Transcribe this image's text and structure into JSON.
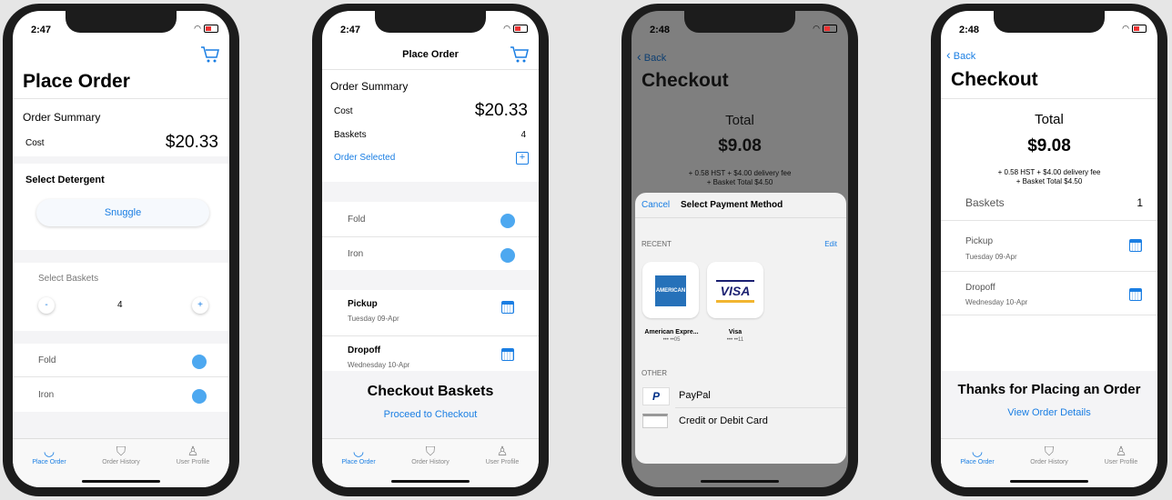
{
  "colors": {
    "accent": "#1a7ee3",
    "toggle": "#4da8f0",
    "amex": "#2671b9",
    "visa_gold": "#f2b530",
    "visa_blue": "#1a1f71",
    "paypal": "#003087"
  },
  "icons": {
    "cart": "cart-icon",
    "calendar": "calendar-icon",
    "back": "chevron-left-icon"
  },
  "tabs": [
    {
      "label": "Place Order",
      "icon": "basket-icon"
    },
    {
      "label": "Order History",
      "icon": "shirt-icon"
    },
    {
      "label": "User Profile",
      "icon": "person-icon"
    }
  ],
  "s1": {
    "time": "2:47",
    "title": "Place Order",
    "order_summary": "Order Summary",
    "cost_label": "Cost",
    "cost_value": "$20.33",
    "select_detergent": "Select Detergent",
    "detergent": "Snuggle",
    "select_baskets": "Select Baskets",
    "minus": "-",
    "plus": "+",
    "basket_count": "4",
    "fold": "Fold",
    "iron": "Iron"
  },
  "s2": {
    "time": "2:47",
    "nav_title": "Place Order",
    "order_summary": "Order Summary",
    "cost_label": "Cost",
    "cost_value": "$20.33",
    "baskets_label": "Baskets",
    "baskets_value": "4",
    "order_selected": "Order Selected",
    "fold": "Fold",
    "iron": "Iron",
    "pickup": "Pickup",
    "pickup_date": "Tuesday 09-Apr",
    "dropoff": "Dropoff",
    "dropoff_date": "Wednesday 10-Apr",
    "checkout_title": "Checkout Baskets",
    "proceed": "Proceed to Checkout"
  },
  "s3": {
    "time": "2:48",
    "back": "Back",
    "title": "Checkout",
    "total_label": "Total",
    "total_value": "$9.08",
    "fee_line1": "+ 0.58 HST + $4.00 delivery fee",
    "fee_line2": "+ Basket Total $4.50",
    "cancel": "Cancel",
    "sheet_title": "Select Payment Method",
    "recent": "RECENT",
    "edit": "Edit",
    "amex_logo": "AMERICAN EXPRESS",
    "amex_name": "American Expre...",
    "amex_num": "••• ••05",
    "visa_logo": "VISA",
    "visa_name": "Visa",
    "visa_num": "••• ••11",
    "other": "OTHER",
    "paypal": "PayPal",
    "paypal_logo": "P",
    "card": "Credit or Debit Card"
  },
  "s4": {
    "time": "2:48",
    "back": "Back",
    "title": "Checkout",
    "total_label": "Total",
    "total_value": "$9.08",
    "fee_line1": "+ 0.58 HST + $4.00 delivery fee",
    "fee_line2": "+ Basket Total $4.50",
    "baskets_label": "Baskets",
    "baskets_value": "1",
    "pickup": "Pickup",
    "pickup_date": "Tuesday 09-Apr",
    "dropoff": "Dropoff",
    "dropoff_date": "Wednesday 10-Apr",
    "thanks": "Thanks for Placing an Order",
    "view_details": "View Order Details"
  }
}
